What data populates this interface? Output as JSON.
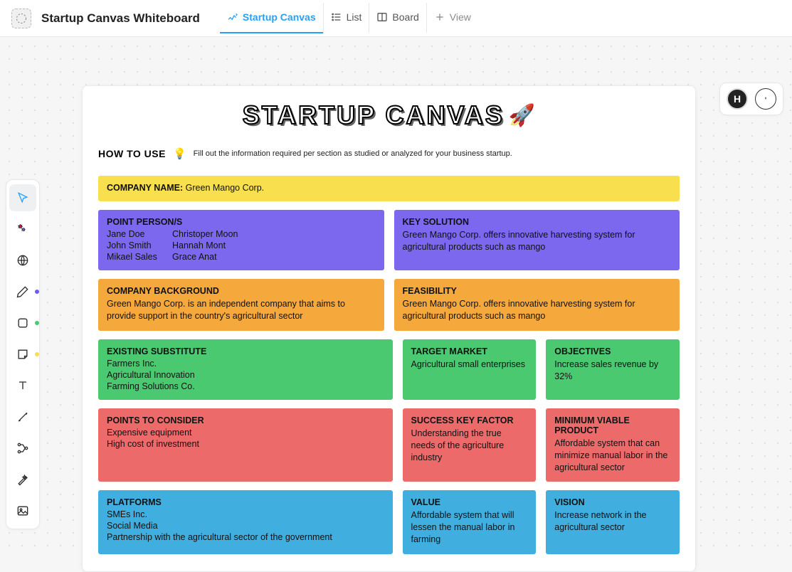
{
  "header": {
    "doc_title": "Startup Canvas Whiteboard",
    "tabs": {
      "canvas": "Startup Canvas",
      "list": "List",
      "board": "Board",
      "add_view": "View"
    }
  },
  "floaters": {
    "avatar_initial": "H"
  },
  "canvas": {
    "title": "STARTUP CANVAS",
    "rocket": "🚀",
    "howto_title": "How to Use",
    "bulb": "💡",
    "howto_text": "Fill out the information required per section as studied or analyzed for your business startup.",
    "company_name_label": "COMPANY NAME:",
    "company_name_value": "Green Mango Corp.",
    "point_persons_label": "POINT PERSON/S",
    "persons": {
      "a1": "Jane Doe",
      "a2": "Christoper Moon",
      "b1": "John Smith",
      "b2": "Hannah Mont",
      "c1": "Mikael Sales",
      "c2": "Grace Anat"
    },
    "key_solution_label": "KEY SOLUTION",
    "key_solution_text": "Green Mango Corp. offers innovative harvesting system for agricultural products such as mango",
    "background_label": "COMPANY BACKGROUND",
    "background_text": "Green Mango Corp. is an independent company that aims to provide support in the country's agricultural sector",
    "feasibility_label": "FEASIBILITY",
    "feasibility_text": "Green Mango Corp. offers innovative harvesting system for agricultural products such as mango",
    "existing_label": "EXISTING SUBSTITUTE",
    "existing_1": "Farmers Inc.",
    "existing_2": "Agricultural Innovation",
    "existing_3": "Farming Solutions Co.",
    "target_label": "TARGET MARKET",
    "target_text": "Agricultural small enterprises",
    "objectives_label": "OBJECTIVES",
    "objectives_text": "Increase sales revenue by 32%",
    "points_label": "POINTS TO CONSIDER",
    "points_1": "Expensive equipment",
    "points_2": "High cost of investment",
    "success_label": "SUCCESS KEY FACTOR",
    "success_text": "Understanding the true needs of the agriculture industry",
    "mvp_label": "MINIMUM VIABLE PRODUCT",
    "mvp_text": "Affordable system that can minimize manual labor in the agricultural sector",
    "platforms_label": "PLATFORMS",
    "platforms_1": "SMEs Inc.",
    "platforms_2": "Social Media",
    "platforms_3": "Partnership with the agricultural sector of the government",
    "value_label": "VALUE",
    "value_text": "Affordable system that will lessen the manual labor in farming",
    "vision_label": "VISION",
    "vision_text": "Increase network in the agricultural sector"
  },
  "tool_dots": {
    "pen": "#6b5cf0",
    "shape": "#4bc971",
    "sticky": "#f7df4d"
  }
}
